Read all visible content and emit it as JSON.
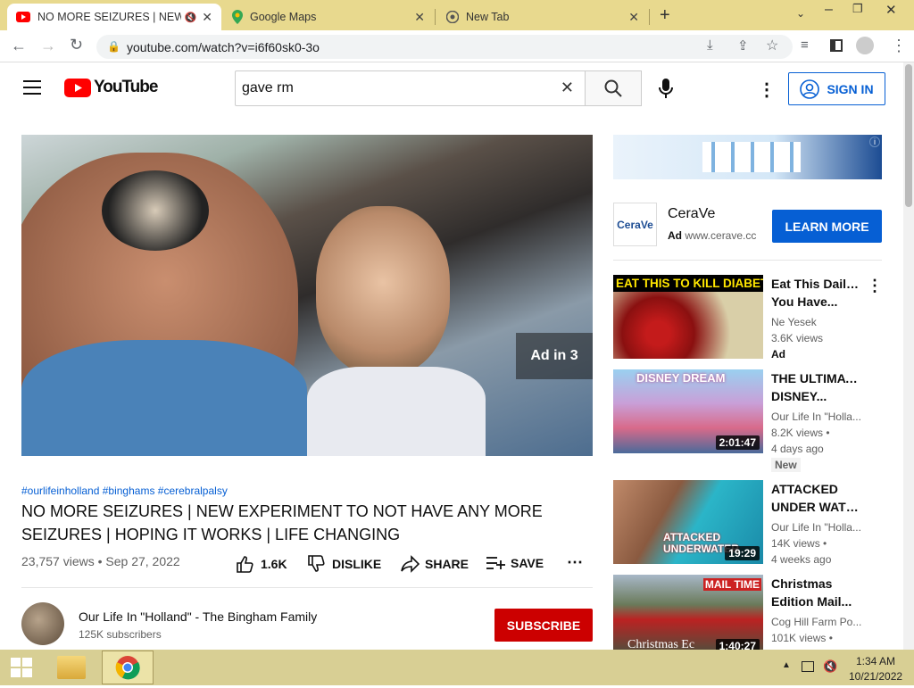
{
  "browser": {
    "tabs": [
      {
        "title": "NO MORE SEIZURES | NEW E",
        "close": "✕"
      },
      {
        "title": "Google Maps",
        "close": "✕"
      },
      {
        "title": "New Tab",
        "close": "✕"
      }
    ],
    "new_tab": "+",
    "url": "youtube.com/watch?v=i6f60sk0-3o"
  },
  "yt": {
    "logo_text": "YouTube",
    "search_value": "gave rm",
    "sign_in": "SIGN IN"
  },
  "video": {
    "ad_marker": "Ad in 3",
    "hashtags": "#ourlifeinholland #binghams #cerebralpalsy",
    "title": "NO MORE SEIZURES | NEW EXPERIMENT TO NOT HAVE ANY MORE SEIZURES | HOPING IT WORKS | LIFE CHANGING",
    "views_date": "23,757 views • Sep 27, 2022",
    "likes": "1.6K",
    "dislike": "DISLIKE",
    "share": "SHARE",
    "save": "SAVE",
    "channel_name": "Our Life In \"Holland\" - The Bingham Family",
    "subscribers": "125K subscribers",
    "subscribe": "SUBSCRIBE"
  },
  "ad": {
    "brand": "CeraVe",
    "ad_label": "Ad",
    "domain": "www.cerave.cc",
    "logo_text": "CeraVe",
    "cta": "LEARN MORE"
  },
  "related": [
    {
      "thumb_text": "EAT THIS TO KILL DIABETES",
      "title_l1": "Eat This Daily If",
      "title_l2": "You Have...",
      "channel": "Ne Yesek",
      "views": "3.6K views",
      "extra": "Ad",
      "duration": ""
    },
    {
      "thumb_text": "DISNEY DREAM",
      "title_l1": "THE ULTIMATE",
      "title_l2": "DISNEY...",
      "channel": "Our Life In \"Holla...",
      "views": "8.2K views •",
      "extra": "4 days ago",
      "badge": "New",
      "duration": "2:01:47"
    },
    {
      "thumb_text": "ATTACKED UNDERWATER",
      "title_l1": "ATTACKED",
      "title_l2": "UNDER WATE...",
      "channel": "Our Life In \"Holla...",
      "views": "14K views •",
      "extra": "4 weeks ago",
      "duration": "19:29"
    },
    {
      "thumb_text": "MAIL TIME",
      "thumb_sub": "Christmas Ec",
      "title_l1": "Christmas",
      "title_l2": "Edition Mail...",
      "channel": "Cog Hill Farm Po...",
      "views": "101K views •",
      "extra": "",
      "duration": "1:40:27"
    }
  ],
  "taskbar": {
    "time": "1:34 AM",
    "date": "10/21/2022"
  },
  "colors": {
    "yt_red": "#ff0000",
    "blue": "#065fd4",
    "subscribe_red": "#cc0000",
    "tabstrip": "#e8d98e",
    "taskbar": "#d8cf94"
  }
}
